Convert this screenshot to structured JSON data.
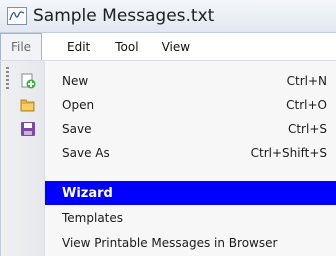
{
  "window": {
    "title": "Sample Messages.txt"
  },
  "menubar": {
    "items": [
      {
        "label": "File"
      },
      {
        "label": "Edit"
      },
      {
        "label": "Tool"
      },
      {
        "label": "View"
      }
    ]
  },
  "file_menu": {
    "items": [
      {
        "label": "New",
        "shortcut": "Ctrl+N",
        "icon": "new-document-icon"
      },
      {
        "label": "Open",
        "shortcut": "Ctrl+O",
        "icon": "folder-open-icon"
      },
      {
        "label": "Save",
        "shortcut": "Ctrl+S",
        "icon": "floppy-disk-icon"
      },
      {
        "label": "Save As",
        "shortcut": "Ctrl+Shift+S"
      },
      {
        "label": "Wizard",
        "highlighted": true
      },
      {
        "label": "Templates"
      },
      {
        "label": "View Printable Messages in Browser"
      }
    ]
  },
  "colors": {
    "highlight": "#0000ff",
    "highlight_text": "#ffffff"
  }
}
